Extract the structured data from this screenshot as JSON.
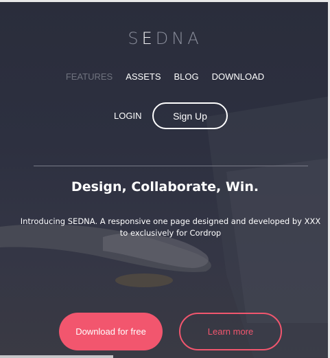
{
  "brand": {
    "logo_pre": "S",
    "logo_highlight": "E",
    "logo_post": "DNA"
  },
  "nav": {
    "items": [
      {
        "label": "FEATURES",
        "active": true
      },
      {
        "label": "ASSETS",
        "active": false
      },
      {
        "label": "BLOG",
        "active": false
      },
      {
        "label": "DOWNLOAD",
        "active": false
      }
    ]
  },
  "auth": {
    "login_label": "LOGIN",
    "signup_label": "Sign Up"
  },
  "hero": {
    "headline": "Design, Collaborate, Win.",
    "intro": "Introducing SEDNA. A responsive one page designed and developed by XXX to exclusively for Cordrop"
  },
  "cta": {
    "download_label": "Download for free",
    "learn_label": "Learn more"
  },
  "colors": {
    "accent": "#f2566e",
    "background": "#2c2f3e",
    "nav_active": "#70737f"
  }
}
